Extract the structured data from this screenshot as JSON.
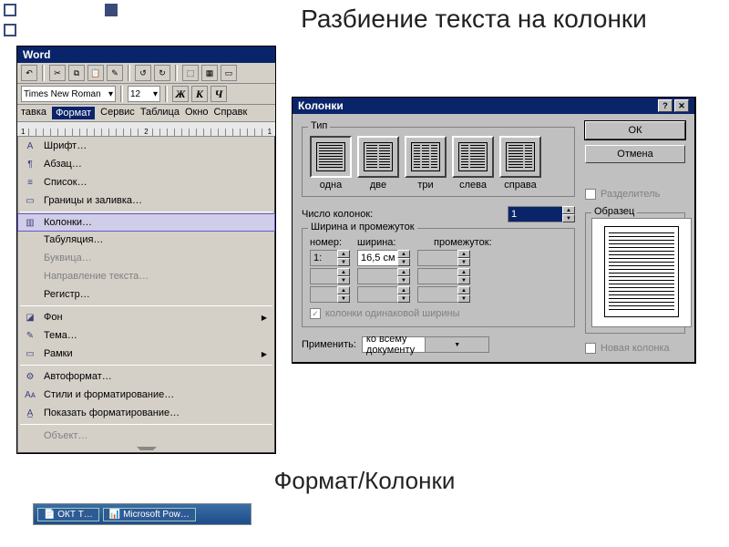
{
  "slide": {
    "title": "Разбиение текста на колонки",
    "caption": "Формат/Колонки"
  },
  "word": {
    "title": "Word",
    "font": "Times New Roman",
    "size": "12",
    "style_buttons": {
      "b": "Ж",
      "i": "К",
      "u": "Ч"
    },
    "menubar": {
      "m1": "тавка",
      "m2": "Формат",
      "m3": "Сервис",
      "m4": "Таблица",
      "m5": "Окно",
      "m6": "Справк"
    },
    "menu": [
      {
        "icon": "A",
        "label": "Шрифт…"
      },
      {
        "icon": "¶",
        "label": "Абзац…"
      },
      {
        "icon": "≡",
        "label": "Список…"
      },
      {
        "icon": "▭",
        "label": "Границы и заливка…"
      },
      {
        "sep": true
      },
      {
        "icon": "▥",
        "label": "Колонки…",
        "sel": true
      },
      {
        "icon": "",
        "label": "Табуляция…"
      },
      {
        "icon": "",
        "label": "Буквица…",
        "disabled": true
      },
      {
        "icon": "",
        "label": "Направление текста…",
        "disabled": true
      },
      {
        "icon": "",
        "label": "Регистр…"
      },
      {
        "sep": true
      },
      {
        "icon": "◪",
        "label": "Фон",
        "arrow": true
      },
      {
        "icon": "✎",
        "label": "Тема…"
      },
      {
        "icon": "▭",
        "label": "Рамки",
        "arrow": true
      },
      {
        "sep": true
      },
      {
        "icon": "⚙",
        "label": "Автоформат…"
      },
      {
        "icon": "Aᴀ",
        "label": "Стили и форматирование…"
      },
      {
        "icon": "A̲",
        "label": "Показать форматирование…"
      },
      {
        "sep": true
      },
      {
        "icon": "",
        "label": "Объект…",
        "disabled": true
      }
    ]
  },
  "dialog": {
    "title": "Колонки",
    "group_type": "Тип",
    "presets": {
      "one": "одна",
      "two": "две",
      "three": "три",
      "left": "слева",
      "right": "справа"
    },
    "ok": "ОК",
    "cancel": "Отмена",
    "sep_chk": "Разделитель",
    "num_label": "Число колонок:",
    "num_value": "1",
    "group_width": "Ширина и промежуток",
    "wh": {
      "num": "номер:",
      "w": "ширина:",
      "g": "промежуток:"
    },
    "row1": {
      "num": "1:",
      "w": "16,5 см"
    },
    "same_chk": "колонки одинаковой ширины",
    "preview_label": "Образец",
    "apply_label": "Применить:",
    "apply_value": "ко всему документу",
    "newcol_chk": "Новая колонка"
  },
  "taskbar": {
    "a": "ОКТ Т…",
    "b": "Microsoft Pow…"
  }
}
